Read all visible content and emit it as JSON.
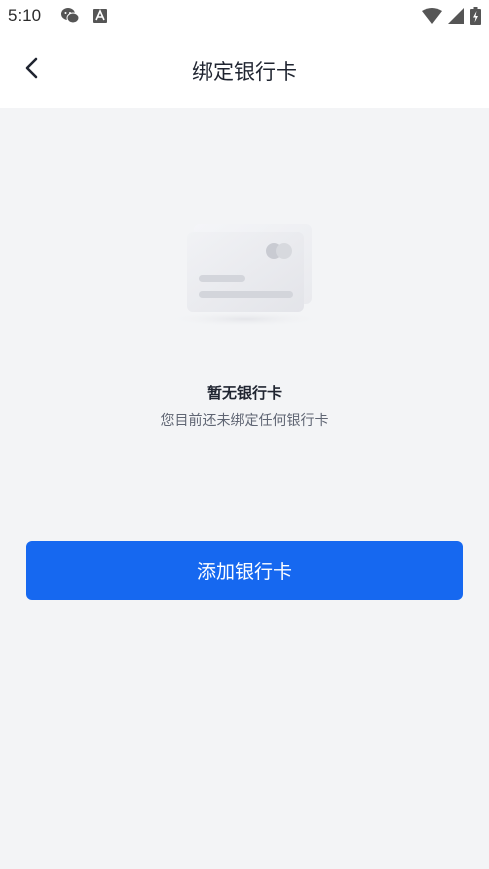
{
  "status_bar": {
    "time": "5:10",
    "left_icons": [
      "wechat-icon",
      "font-app-icon"
    ],
    "right_icons": [
      "wifi-icon",
      "signal-icon",
      "battery-charging-icon"
    ]
  },
  "header": {
    "back_icon": "chevron-left-icon",
    "title": "绑定银行卡"
  },
  "empty_state": {
    "illustration": "bank-card-icon",
    "title": "暂无银行卡",
    "subtitle": "您目前还未绑定任何银行卡"
  },
  "actions": {
    "add_card_label": "添加银行卡"
  },
  "colors": {
    "primary": "#1668f0",
    "background": "#f3f4f6",
    "surface": "#ffffff"
  }
}
